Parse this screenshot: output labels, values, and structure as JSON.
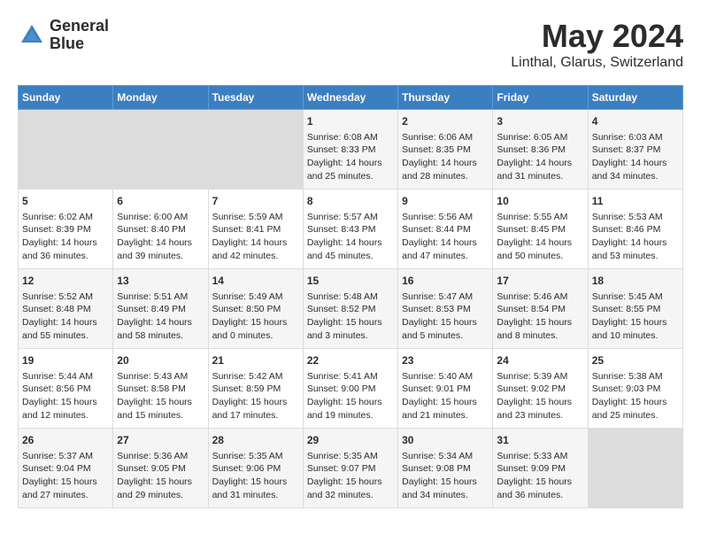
{
  "header": {
    "logo_line1": "General",
    "logo_line2": "Blue",
    "main_title": "May 2024",
    "subtitle": "Linthal, Glarus, Switzerland"
  },
  "calendar": {
    "days_of_week": [
      "Sunday",
      "Monday",
      "Tuesday",
      "Wednesday",
      "Thursday",
      "Friday",
      "Saturday"
    ],
    "weeks": [
      [
        {
          "day": "",
          "content": ""
        },
        {
          "day": "",
          "content": ""
        },
        {
          "day": "",
          "content": ""
        },
        {
          "day": "1",
          "content": "Sunrise: 6:08 AM\nSunset: 8:33 PM\nDaylight: 14 hours\nand 25 minutes."
        },
        {
          "day": "2",
          "content": "Sunrise: 6:06 AM\nSunset: 8:35 PM\nDaylight: 14 hours\nand 28 minutes."
        },
        {
          "day": "3",
          "content": "Sunrise: 6:05 AM\nSunset: 8:36 PM\nDaylight: 14 hours\nand 31 minutes."
        },
        {
          "day": "4",
          "content": "Sunrise: 6:03 AM\nSunset: 8:37 PM\nDaylight: 14 hours\nand 34 minutes."
        }
      ],
      [
        {
          "day": "5",
          "content": "Sunrise: 6:02 AM\nSunset: 8:39 PM\nDaylight: 14 hours\nand 36 minutes."
        },
        {
          "day": "6",
          "content": "Sunrise: 6:00 AM\nSunset: 8:40 PM\nDaylight: 14 hours\nand 39 minutes."
        },
        {
          "day": "7",
          "content": "Sunrise: 5:59 AM\nSunset: 8:41 PM\nDaylight: 14 hours\nand 42 minutes."
        },
        {
          "day": "8",
          "content": "Sunrise: 5:57 AM\nSunset: 8:43 PM\nDaylight: 14 hours\nand 45 minutes."
        },
        {
          "day": "9",
          "content": "Sunrise: 5:56 AM\nSunset: 8:44 PM\nDaylight: 14 hours\nand 47 minutes."
        },
        {
          "day": "10",
          "content": "Sunrise: 5:55 AM\nSunset: 8:45 PM\nDaylight: 14 hours\nand 50 minutes."
        },
        {
          "day": "11",
          "content": "Sunrise: 5:53 AM\nSunset: 8:46 PM\nDaylight: 14 hours\nand 53 minutes."
        }
      ],
      [
        {
          "day": "12",
          "content": "Sunrise: 5:52 AM\nSunset: 8:48 PM\nDaylight: 14 hours\nand 55 minutes."
        },
        {
          "day": "13",
          "content": "Sunrise: 5:51 AM\nSunset: 8:49 PM\nDaylight: 14 hours\nand 58 minutes."
        },
        {
          "day": "14",
          "content": "Sunrise: 5:49 AM\nSunset: 8:50 PM\nDaylight: 15 hours\nand 0 minutes."
        },
        {
          "day": "15",
          "content": "Sunrise: 5:48 AM\nSunset: 8:52 PM\nDaylight: 15 hours\nand 3 minutes."
        },
        {
          "day": "16",
          "content": "Sunrise: 5:47 AM\nSunset: 8:53 PM\nDaylight: 15 hours\nand 5 minutes."
        },
        {
          "day": "17",
          "content": "Sunrise: 5:46 AM\nSunset: 8:54 PM\nDaylight: 15 hours\nand 8 minutes."
        },
        {
          "day": "18",
          "content": "Sunrise: 5:45 AM\nSunset: 8:55 PM\nDaylight: 15 hours\nand 10 minutes."
        }
      ],
      [
        {
          "day": "19",
          "content": "Sunrise: 5:44 AM\nSunset: 8:56 PM\nDaylight: 15 hours\nand 12 minutes."
        },
        {
          "day": "20",
          "content": "Sunrise: 5:43 AM\nSunset: 8:58 PM\nDaylight: 15 hours\nand 15 minutes."
        },
        {
          "day": "21",
          "content": "Sunrise: 5:42 AM\nSunset: 8:59 PM\nDaylight: 15 hours\nand 17 minutes."
        },
        {
          "day": "22",
          "content": "Sunrise: 5:41 AM\nSunset: 9:00 PM\nDaylight: 15 hours\nand 19 minutes."
        },
        {
          "day": "23",
          "content": "Sunrise: 5:40 AM\nSunset: 9:01 PM\nDaylight: 15 hours\nand 21 minutes."
        },
        {
          "day": "24",
          "content": "Sunrise: 5:39 AM\nSunset: 9:02 PM\nDaylight: 15 hours\nand 23 minutes."
        },
        {
          "day": "25",
          "content": "Sunrise: 5:38 AM\nSunset: 9:03 PM\nDaylight: 15 hours\nand 25 minutes."
        }
      ],
      [
        {
          "day": "26",
          "content": "Sunrise: 5:37 AM\nSunset: 9:04 PM\nDaylight: 15 hours\nand 27 minutes."
        },
        {
          "day": "27",
          "content": "Sunrise: 5:36 AM\nSunset: 9:05 PM\nDaylight: 15 hours\nand 29 minutes."
        },
        {
          "day": "28",
          "content": "Sunrise: 5:35 AM\nSunset: 9:06 PM\nDaylight: 15 hours\nand 31 minutes."
        },
        {
          "day": "29",
          "content": "Sunrise: 5:35 AM\nSunset: 9:07 PM\nDaylight: 15 hours\nand 32 minutes."
        },
        {
          "day": "30",
          "content": "Sunrise: 5:34 AM\nSunset: 9:08 PM\nDaylight: 15 hours\nand 34 minutes."
        },
        {
          "day": "31",
          "content": "Sunrise: 5:33 AM\nSunset: 9:09 PM\nDaylight: 15 hours\nand 36 minutes."
        },
        {
          "day": "",
          "content": ""
        }
      ]
    ]
  }
}
